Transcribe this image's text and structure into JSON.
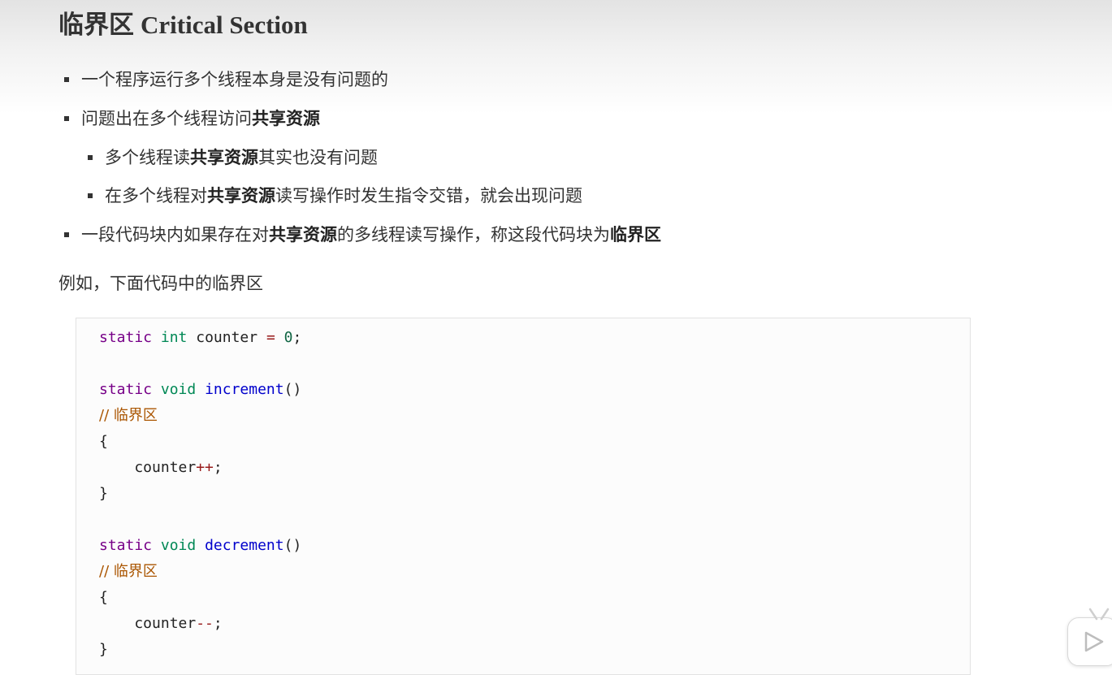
{
  "title": {
    "cn": "临界区",
    "en": "Critical Section"
  },
  "bullets": [
    {
      "parts": [
        {
          "text": "一个程序运行多个线程本身是没有问题的",
          "bold": false
        }
      ]
    },
    {
      "parts": [
        {
          "text": "问题出在多个线程访问",
          "bold": false
        },
        {
          "text": "共享资源",
          "bold": true
        }
      ]
    },
    {
      "parts": [
        {
          "text": "多个线程读",
          "bold": false
        },
        {
          "text": "共享资源",
          "bold": true
        },
        {
          "text": "其实也没有问题",
          "bold": false
        }
      ]
    },
    {
      "parts": [
        {
          "text": "在多个线程对",
          "bold": false
        },
        {
          "text": "共享资源",
          "bold": true
        },
        {
          "text": "读写操作时发生指令交错，就会出现问题",
          "bold": false
        }
      ]
    },
    {
      "parts": [
        {
          "text": "一段代码块内如果存在对",
          "bold": false
        },
        {
          "text": "共享资源",
          "bold": true
        },
        {
          "text": "的多线程读写操作，称这段代码块为",
          "bold": false
        },
        {
          "text": "临界区",
          "bold": true
        }
      ]
    }
  ],
  "intro": "例如，下面代码中的临界区",
  "code": {
    "lines": [
      [
        {
          "t": "static",
          "c": "kw"
        },
        {
          "t": " ",
          "c": "plain"
        },
        {
          "t": "int",
          "c": "ty"
        },
        {
          "t": " counter ",
          "c": "plain"
        },
        {
          "t": "=",
          "c": "op"
        },
        {
          "t": " ",
          "c": "plain"
        },
        {
          "t": "0",
          "c": "num"
        },
        {
          "t": ";",
          "c": "plain"
        }
      ],
      [],
      [
        {
          "t": "static",
          "c": "kw"
        },
        {
          "t": " ",
          "c": "plain"
        },
        {
          "t": "void",
          "c": "ty"
        },
        {
          "t": " ",
          "c": "plain"
        },
        {
          "t": "increment",
          "c": "fn"
        },
        {
          "t": "()",
          "c": "plain"
        }
      ],
      [
        {
          "t": "// 临界区",
          "c": "cm"
        }
      ],
      [
        {
          "t": "{",
          "c": "plain"
        }
      ],
      [
        {
          "t": "    counter",
          "c": "plain"
        },
        {
          "t": "++",
          "c": "op"
        },
        {
          "t": ";",
          "c": "plain"
        }
      ],
      [
        {
          "t": "}",
          "c": "plain"
        }
      ],
      [],
      [
        {
          "t": "static",
          "c": "kw"
        },
        {
          "t": " ",
          "c": "plain"
        },
        {
          "t": "void",
          "c": "ty"
        },
        {
          "t": " ",
          "c": "plain"
        },
        {
          "t": "decrement",
          "c": "fn"
        },
        {
          "t": "()",
          "c": "plain"
        }
      ],
      [
        {
          "t": "// 临界区",
          "c": "cm"
        }
      ],
      [
        {
          "t": "{",
          "c": "plain"
        }
      ],
      [
        {
          "t": "    counter",
          "c": "plain"
        },
        {
          "t": "--",
          "c": "op"
        },
        {
          "t": ";",
          "c": "plain"
        }
      ],
      [
        {
          "t": "}",
          "c": "plain"
        }
      ]
    ]
  },
  "icons": {
    "play": "play-icon"
  },
  "colors": {
    "keyword": "#770088",
    "type": "#008855",
    "function": "#0000cc",
    "number": "#116644",
    "operator": "#981a1a",
    "comment": "#aa5500"
  }
}
